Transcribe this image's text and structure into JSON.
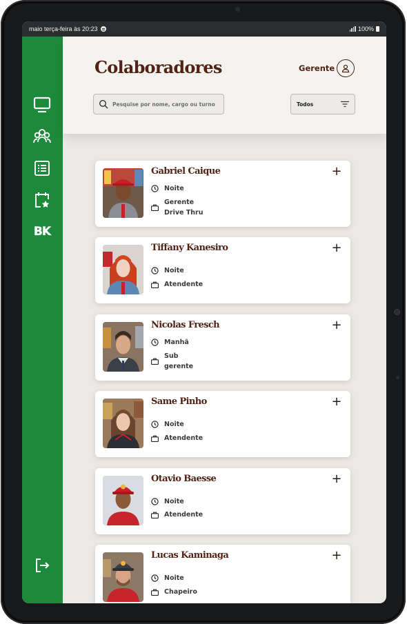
{
  "status_bar": {
    "datetime": "maio terça-feira às 20:23",
    "battery": "100%"
  },
  "colors": {
    "sidebar": "#1d8a3b",
    "title": "#502314",
    "background": "#ebe9e5"
  },
  "sidebar": {
    "items": [
      {
        "icon": "monitor-icon"
      },
      {
        "icon": "team-icon"
      },
      {
        "icon": "list-icon"
      },
      {
        "icon": "calendar-star-icon"
      },
      {
        "icon": "bk-logo",
        "label": "BK"
      },
      {
        "icon": "logout-icon"
      }
    ]
  },
  "header": {
    "title": "Colaboradores",
    "role": "Gerente",
    "search_placeholder": "Pesquise por nome, cargo ou turno",
    "filter_value": "Todos"
  },
  "employees": [
    {
      "name": "Gabriel Caique",
      "shift": "Noite",
      "role_line1": "Gerente",
      "role_line2": "Drive Thru"
    },
    {
      "name": "Tiffany Kanesiro",
      "shift": "Noite",
      "role_line1": "Atendente",
      "role_line2": ""
    },
    {
      "name": "Nicolas Fresch",
      "shift": "Manhã",
      "role_line1": "Sub",
      "role_line2": "gerente"
    },
    {
      "name": "Same Pinho",
      "shift": "Noite",
      "role_line1": "Atendente",
      "role_line2": ""
    },
    {
      "name": "Otavio Baesse",
      "shift": "Noite",
      "role_line1": "Atendente",
      "role_line2": ""
    },
    {
      "name": "Lucas Kaminaga",
      "shift": "Noite",
      "role_line1": "Chapeiro",
      "role_line2": ""
    }
  ]
}
